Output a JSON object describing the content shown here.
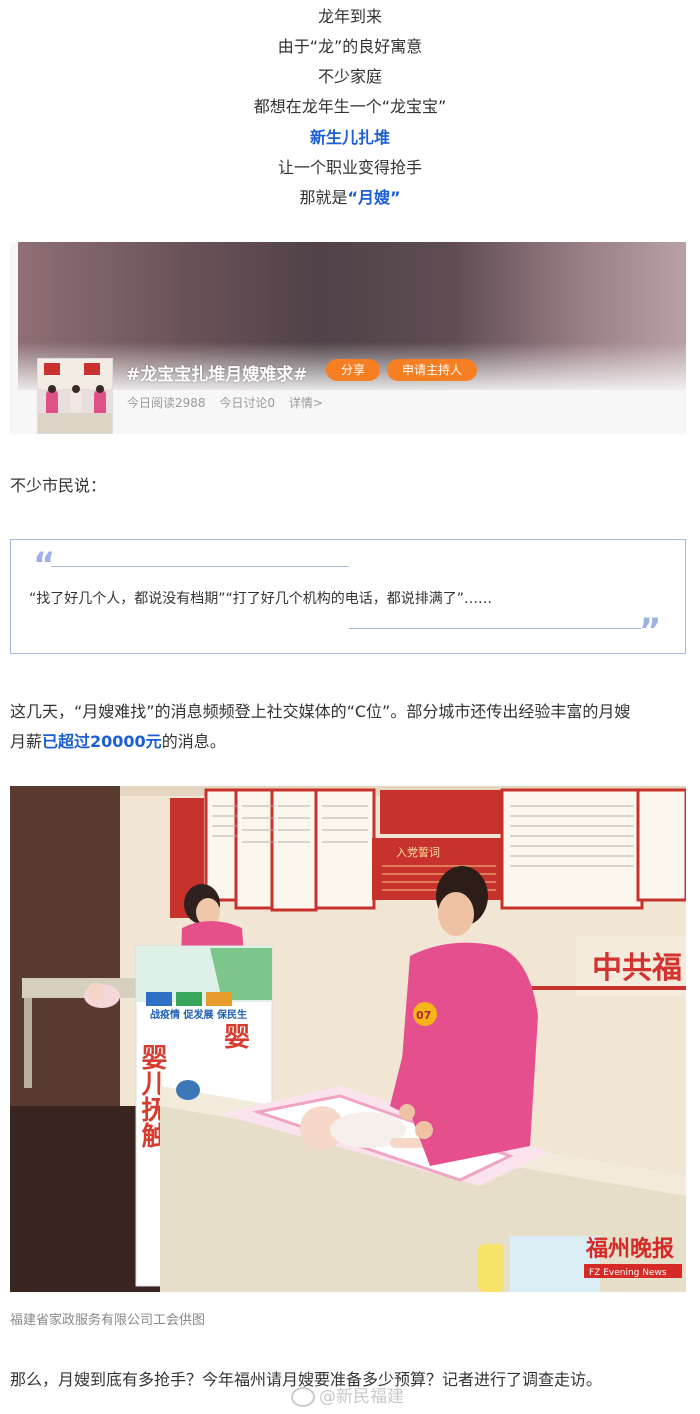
{
  "intro": {
    "l1": "龙年到来",
    "l2": "由于“龙”的良好寓意",
    "l3": "不少家庭",
    "l4": "都想在龙年生一个“龙宝宝”",
    "l5": "新生儿扎堆",
    "l6": "让一个职业变得抢手",
    "l7_prefix": "那就是",
    "l7_highlight": "“月嫂”"
  },
  "topic": {
    "title": "#龙宝宝扎堆月嫂难求#",
    "share_label": "分享",
    "host_label": "申请主持人",
    "reads": "今日阅读2988",
    "discussions": "今日讨论0",
    "details": "详情>"
  },
  "para1": "不少市民说：",
  "quote": {
    "text": "“找了好几个人，都说没有档期”“打了好几个机构的电话，都说排满了”……",
    "open_mark": "“",
    "close_mark": "”"
  },
  "para2": {
    "part1": "这几天，“月嫂难找”的消息频频登上社交媒体的“C位”。部分城市还传出经验丰富的月嫂",
    "part2_prefix": "月薪",
    "part2_highlight": "已超过20000元",
    "part2_suffix": "的消息。"
  },
  "photo": {
    "red_sign": "中共福",
    "vertical_sign": "婴儿抚触",
    "vertical_sign_right": "婴",
    "oath_title": "入党誓词",
    "badge_number": "07",
    "logo_cn": "福州晚报",
    "logo_en": "FZ Evening News"
  },
  "caption": "福建省家政服务有限公司工会供图",
  "para3": "那么，月嫂到底有多抢手？今年福州请月嫂要准备多少预算？记者进行了调查走访。",
  "watermark": "@新民福建",
  "colors": {
    "accent_blue": "#1c5ed6",
    "pill_orange": "#f57f22",
    "quote_border": "#a8b8df"
  }
}
